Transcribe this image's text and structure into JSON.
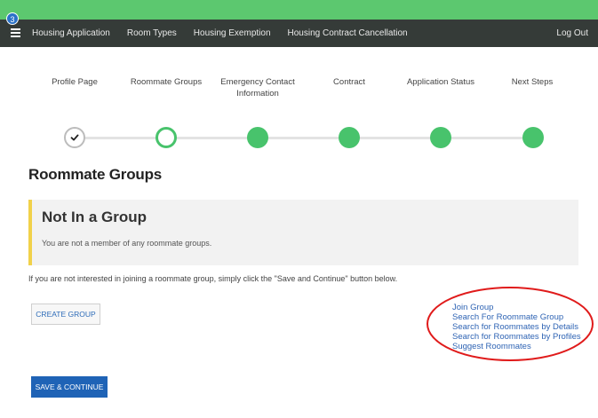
{
  "header": {
    "notification_count": "3",
    "nav_items": [
      "Housing Application",
      "Room Types",
      "Housing Exemption",
      "Housing Contract Cancellation"
    ],
    "logout_label": "Log Out"
  },
  "steps": [
    {
      "label": "Profile Page",
      "state": "done"
    },
    {
      "label": "Roommate Groups",
      "state": "current"
    },
    {
      "label": "Emergency Contact Information",
      "state": "pending"
    },
    {
      "label": "Contract",
      "state": "pending"
    },
    {
      "label": "Application Status",
      "state": "pending"
    },
    {
      "label": "Next Steps",
      "state": "pending"
    }
  ],
  "main": {
    "title": "Roommate Groups",
    "group_status_title": "Not In a Group",
    "group_status_text": "You are not a member of any roommate groups.",
    "info_text": "If you are not interested in joining a roommate group, simply click the \"Save and Continue\" button below.",
    "create_group_label": "CREATE GROUP",
    "links": [
      "Join Group",
      "Search For Roommate Group",
      "Search for Roommates by Details",
      "Search for Roommates by Profiles",
      "Suggest Roommates"
    ],
    "save_label": "SAVE & CONTINUE"
  },
  "colors": {
    "top_strip": "#5cc86f",
    "navbar": "#353b38",
    "step_active": "#48c36c",
    "callout_border": "#f1d14a",
    "link": "#2f64b4",
    "primary_button": "#1f63b6",
    "annotation": "#e01b1b"
  }
}
